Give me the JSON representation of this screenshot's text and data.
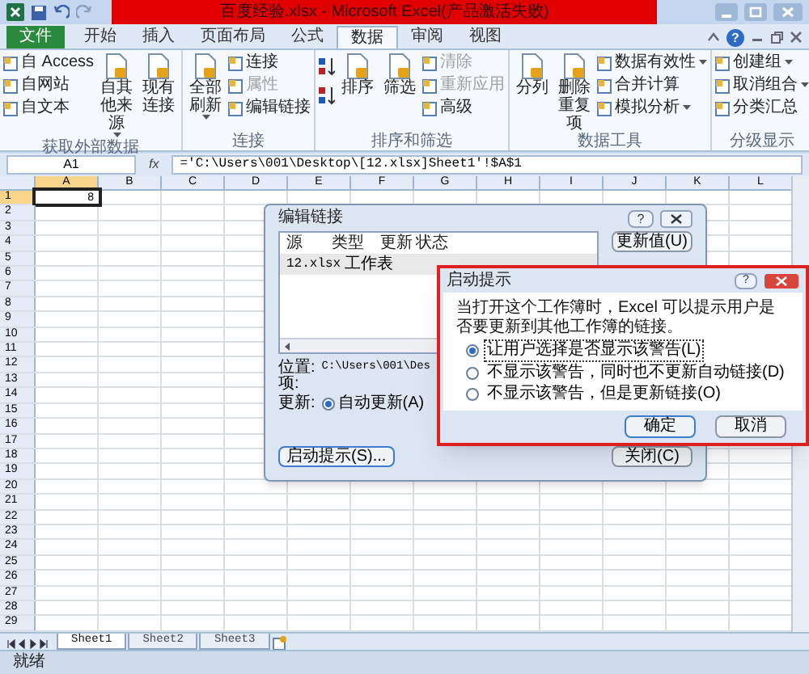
{
  "window": {
    "title": "百度经验.xlsx - Microsoft Excel(产品激活失败)"
  },
  "help": "?",
  "tabs": [
    {
      "label": "文件",
      "kind": "file",
      "selected": false
    },
    {
      "label": "开始",
      "kind": "tab",
      "selected": false
    },
    {
      "label": "插入",
      "kind": "tab",
      "selected": false
    },
    {
      "label": "页面布局",
      "kind": "tab",
      "selected": false
    },
    {
      "label": "公式",
      "kind": "tab",
      "selected": false
    },
    {
      "label": "数据",
      "kind": "tab",
      "selected": true
    },
    {
      "label": "审阅",
      "kind": "tab",
      "selected": false
    },
    {
      "label": "视图",
      "kind": "tab",
      "selected": false
    }
  ],
  "ribbon": {
    "groups": [
      {
        "label": "获取外部数据",
        "items": [
          {
            "kind": "small",
            "label": "自 Access",
            "disabled": false,
            "dropdown": false
          },
          {
            "kind": "small",
            "label": "自网站",
            "disabled": false,
            "dropdown": false
          },
          {
            "kind": "small",
            "label": "自文本",
            "disabled": false,
            "dropdown": false
          },
          {
            "kind": "large",
            "label": "自其他来源",
            "disabled": false,
            "dropdown": true
          },
          {
            "kind": "large",
            "label": "现有连接",
            "disabled": false,
            "dropdown": false
          }
        ]
      },
      {
        "label": "连接",
        "items": [
          {
            "kind": "large",
            "label": "全部刷新",
            "disabled": false,
            "dropdown": true
          },
          {
            "kind": "small",
            "label": "连接",
            "disabled": false,
            "dropdown": false
          },
          {
            "kind": "small",
            "label": "属性",
            "disabled": true,
            "dropdown": false
          },
          {
            "kind": "small",
            "label": "编辑链接",
            "disabled": false,
            "dropdown": false
          }
        ]
      },
      {
        "label": "排序和筛选",
        "items": [
          {
            "kind": "sorticons"
          },
          {
            "kind": "large",
            "label": "排序",
            "disabled": false,
            "dropdown": false
          },
          {
            "kind": "large",
            "label": "筛选",
            "disabled": false,
            "dropdown": false
          },
          {
            "kind": "small",
            "label": "清除",
            "disabled": true,
            "dropdown": false
          },
          {
            "kind": "small",
            "label": "重新应用",
            "disabled": true,
            "dropdown": false
          },
          {
            "kind": "small",
            "label": "高级",
            "disabled": false,
            "dropdown": false
          }
        ]
      },
      {
        "label": "数据工具",
        "items": [
          {
            "kind": "large",
            "label": "分列",
            "disabled": false,
            "dropdown": false
          },
          {
            "kind": "large",
            "label": "删除重复项",
            "disabled": false,
            "dropdown": false
          },
          {
            "kind": "small",
            "label": "数据有效性",
            "disabled": false,
            "dropdown": true
          },
          {
            "kind": "small",
            "label": "合并计算",
            "disabled": false,
            "dropdown": false
          },
          {
            "kind": "small",
            "label": "模拟分析",
            "disabled": false,
            "dropdown": true
          }
        ]
      },
      {
        "label": "分级显示",
        "items": [
          {
            "kind": "small",
            "label": "创建组",
            "disabled": false,
            "dropdown": true
          },
          {
            "kind": "small",
            "label": "取消组合",
            "disabled": false,
            "dropdown": true
          },
          {
            "kind": "small",
            "label": "分类汇总",
            "disabled": false,
            "dropdown": false
          }
        ]
      }
    ]
  },
  "formula_bar": {
    "name_box": "A1",
    "fx": "fx",
    "formula": "='C:\\Users\\001\\Desktop\\[12.xlsx]Sheet1'!$A$1"
  },
  "sheet": {
    "columns": [
      "A",
      "B",
      "C",
      "D",
      "E",
      "F",
      "G",
      "H",
      "I",
      "J",
      "K",
      "L"
    ],
    "row_numbers": [
      "1",
      "2",
      "3",
      "4",
      "5",
      "6",
      "7",
      "8",
      "9",
      "10",
      "11",
      "12",
      "13",
      "14",
      "15",
      "16",
      "17",
      "18",
      "19",
      "20",
      "21",
      "22",
      "23",
      "24",
      "25",
      "26",
      "27",
      "28",
      "29"
    ],
    "rows": [
      {
        "cells": [
          {
            "value": "8",
            "selected": true
          }
        ]
      }
    ]
  },
  "edit_links_dialog": {
    "title": "编辑链接",
    "help": "?",
    "columns": [
      "源",
      "类型",
      "更新",
      "状态"
    ],
    "rows": [
      {
        "source": "12.xlsx",
        "type": "工作表"
      }
    ],
    "location_label": "位置:",
    "location": "C:\\Users\\001\\Des",
    "item_label": "项:",
    "update_label": "更新:",
    "update_option": {
      "label": "自动更新(A)",
      "selected": true
    },
    "startup_button": "启动提示(S)...",
    "update_values_button": "更新值(U)",
    "close_button": "关闭(C)"
  },
  "startup_prompt_dialog": {
    "title": "启动提示",
    "help": "?",
    "message": "当打开这个工作簿时，Excel 可以提示用户是否要更新到其他工作簿的链接。",
    "options": [
      {
        "label": "让用户选择是否显示该警告(L)",
        "selected": true
      },
      {
        "label": "不显示该警告，同时也不更新自动链接(D)",
        "selected": false
      },
      {
        "label": "不显示该警告，但是更新链接(O)",
        "selected": false
      }
    ],
    "buttons": [
      "确定",
      "取消"
    ]
  },
  "sheet_tabs": [
    {
      "label": "Sheet1",
      "selected": true
    },
    {
      "label": "Sheet2",
      "selected": false
    },
    {
      "label": "Sheet3",
      "selected": false
    }
  ],
  "status_bar": {
    "text": "就绪"
  }
}
